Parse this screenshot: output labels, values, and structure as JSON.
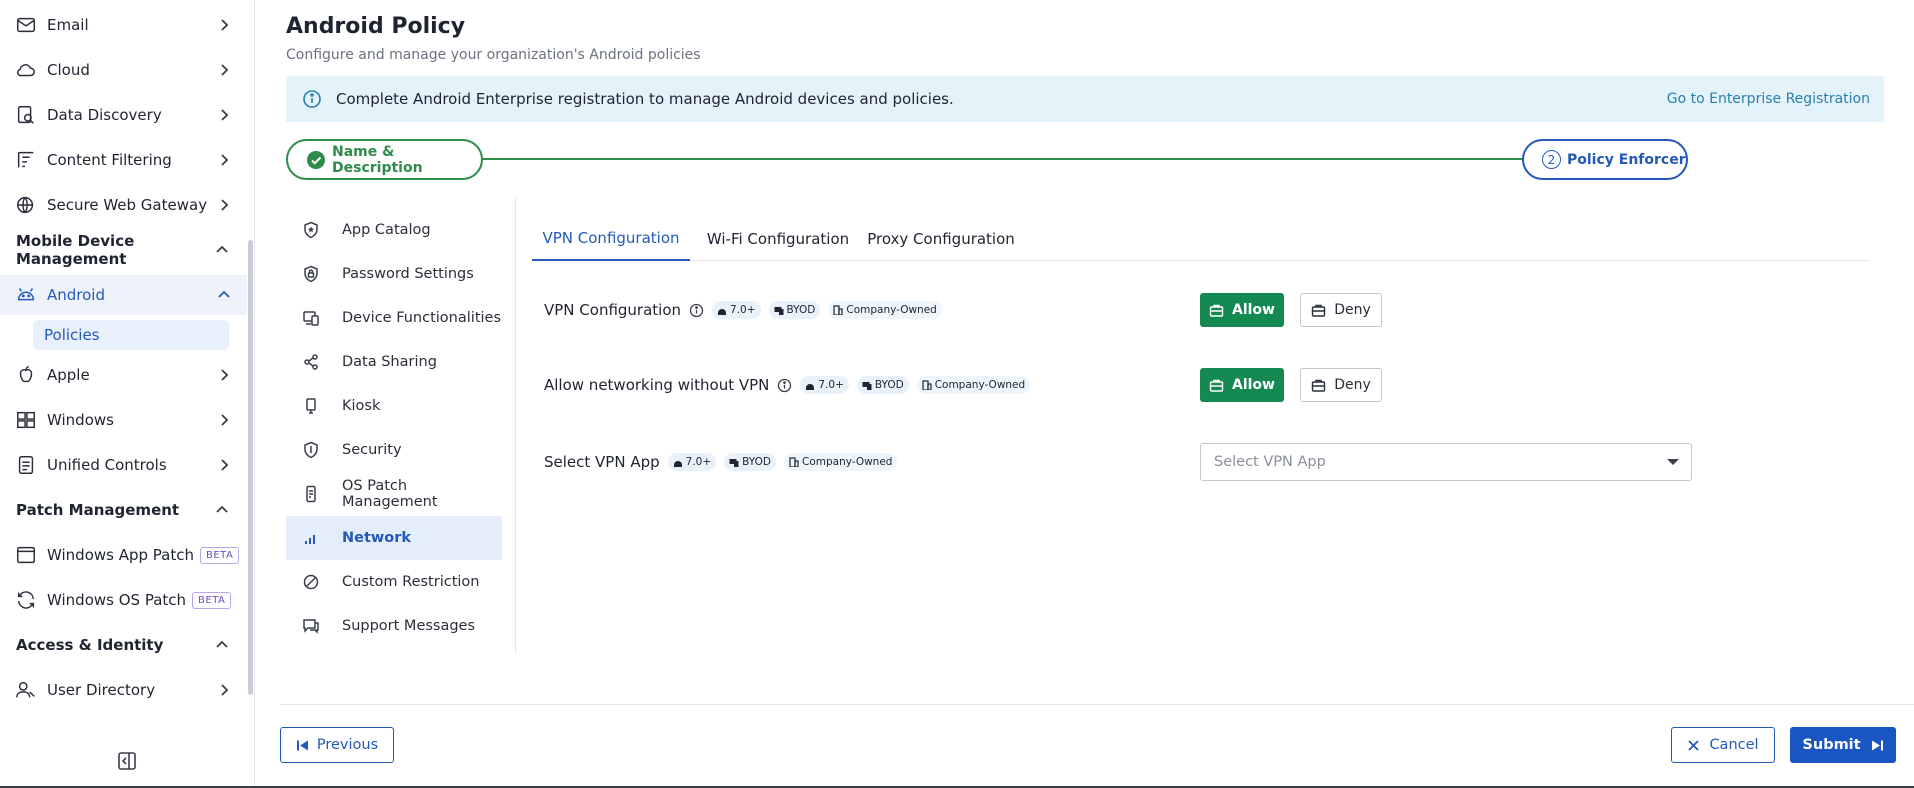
{
  "sidebar": {
    "items": [
      {
        "label": "Email",
        "icon": "mail-icon"
      },
      {
        "label": "Cloud",
        "icon": "cloud-icon"
      },
      {
        "label": "Data Discovery",
        "icon": "data-discovery-icon"
      },
      {
        "label": "Content Filtering",
        "icon": "content-filter-icon"
      },
      {
        "label": "Secure Web Gateway",
        "icon": "globe-shield-icon"
      }
    ],
    "sections": [
      {
        "label": "Mobile Device Management"
      },
      {
        "label": "Patch Management"
      },
      {
        "label": "Access & Identity"
      }
    ],
    "mdm_items": [
      {
        "label": "Android",
        "icon": "android-icon",
        "active": true
      },
      {
        "label": "Apple",
        "icon": "apple-icon"
      },
      {
        "label": "Windows",
        "icon": "windows-icon"
      },
      {
        "label": "Unified Controls",
        "icon": "unified-controls-icon"
      }
    ],
    "sub_item": "Policies",
    "patch_items": [
      {
        "label": "Windows App Patch",
        "badge": "BETA",
        "icon": "app-window-icon"
      },
      {
        "label": "Windows OS Patch",
        "badge": "BETA",
        "icon": "refresh-icon"
      }
    ],
    "access_items": [
      {
        "label": "User Directory",
        "icon": "user-directory-icon"
      }
    ]
  },
  "page": {
    "title": "Android Policy",
    "subtitle": "Configure and manage your organization's Android policies"
  },
  "banner": {
    "message": "Complete Android Enterprise registration to manage Android devices and policies.",
    "link": "Go to Enterprise Registration"
  },
  "stepper": {
    "step1": "Name & Description",
    "step2_number": "2",
    "step2": "Policy Enforcer"
  },
  "policy_menu": [
    {
      "label": "App Catalog",
      "icon": "shield-star-icon"
    },
    {
      "label": "Password Settings",
      "icon": "shield-lock-icon"
    },
    {
      "label": "Device Functionalities",
      "icon": "devices-icon"
    },
    {
      "label": "Data Sharing",
      "icon": "share-icon"
    },
    {
      "label": "Kiosk",
      "icon": "kiosk-icon"
    },
    {
      "label": "Security",
      "icon": "shield-icon"
    },
    {
      "label": "OS Patch Management",
      "icon": "phone-patch-icon"
    },
    {
      "label": "Network",
      "icon": "signal-icon",
      "active": true
    },
    {
      "label": "Custom Restriction",
      "icon": "block-icon"
    },
    {
      "label": "Support Messages",
      "icon": "message-icon"
    }
  ],
  "tabs": [
    {
      "label": "VPN Configuration",
      "active": true
    },
    {
      "label": "Wi-Fi Configuration"
    },
    {
      "label": "Proxy Configuration"
    }
  ],
  "settings": [
    {
      "label": "VPN Configuration",
      "version": "7.0+",
      "byod": "BYOD",
      "owned": "Company-Owned",
      "allow": "Allow",
      "deny": "Deny"
    },
    {
      "label": "Allow networking without VPN",
      "version": "7.0+",
      "byod": "BYOD",
      "owned": "Company-Owned",
      "allow": "Allow",
      "deny": "Deny"
    },
    {
      "label": "Select VPN App",
      "version": "7.0+",
      "byod": "BYOD",
      "owned": "Company-Owned",
      "placeholder": "Select VPN App"
    }
  ],
  "footer": {
    "previous": "Previous",
    "cancel": "Cancel",
    "submit": "Submit"
  },
  "colors": {
    "accent": "#2459b8",
    "success": "#2e8b4a",
    "allow": "#148a52",
    "submit": "#1a55c4",
    "banner_bg": "#e4f3fa"
  }
}
